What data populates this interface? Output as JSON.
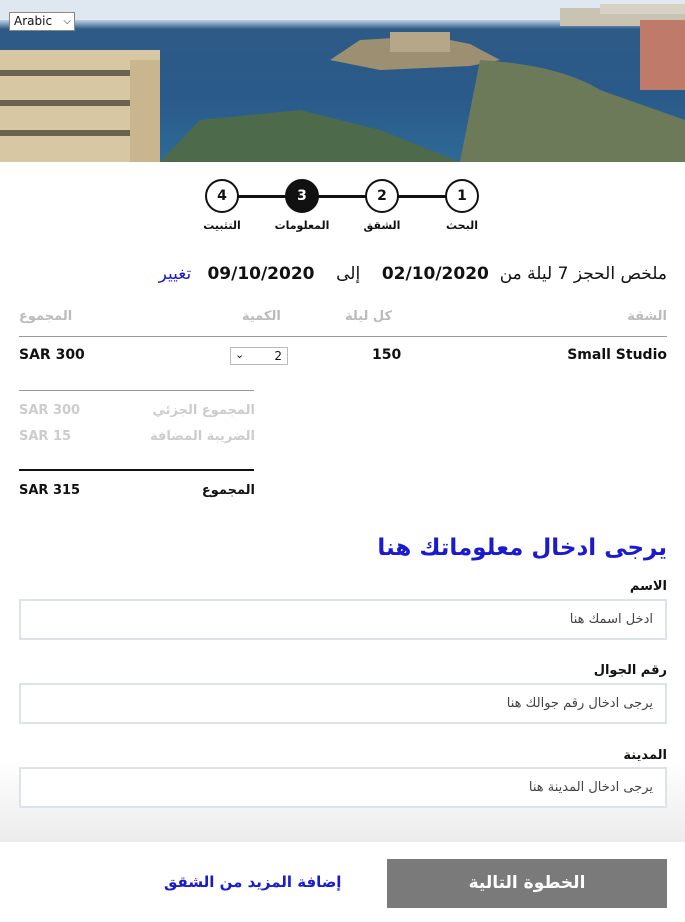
{
  "language": {
    "selected": "Arabic"
  },
  "steps": [
    {
      "number": "4",
      "label": "التثبيت"
    },
    {
      "number": "3",
      "label": "المعلومات"
    },
    {
      "number": "2",
      "label": "الشقق"
    },
    {
      "number": "1",
      "label": "البحث"
    }
  ],
  "summary": {
    "prefix": "ملخص الحجز 7 ليلة من",
    "from_date": "02/10/2020",
    "to_word": "إلى",
    "to_date": "09/10/2020",
    "change_link": "تغيير"
  },
  "table": {
    "headers": {
      "apartment": "الشقة",
      "per_night": "كل ليلة",
      "quantity": "الكمية",
      "total": "المجموع"
    },
    "row": {
      "apartment": "Small Studio",
      "per_night": "150",
      "quantity": "2",
      "total": "SAR 300"
    }
  },
  "totals": {
    "subtotal_label": "المجموع الجزئي",
    "subtotal_value": "SAR 300",
    "tax_label": "الضريبة المضافة",
    "tax_value": "SAR 15",
    "grand_label": "المجموع",
    "grand_value": "SAR 315"
  },
  "form": {
    "title": "يرجى ادخال معلوماتك هنا",
    "name_label": "الاسم",
    "name_placeholder": "ادخل اسمك هنا",
    "phone_label": "رقم الجوال",
    "phone_placeholder": "يرجى ادخال رقم جوالك هنا",
    "city_label": "المدينة",
    "city_placeholder": "يرجى ادخال المدينة هنا"
  },
  "actions": {
    "next_label": "الخطوة التالية",
    "add_more_label": "إضافة المزيد من الشقق"
  },
  "colors": {
    "link": "#1a1ad0",
    "button": "#7a7a7a"
  }
}
